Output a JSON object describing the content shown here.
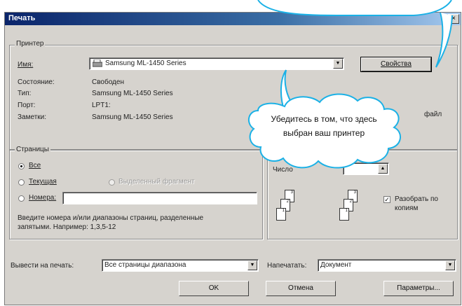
{
  "dialog": {
    "title": "Печать",
    "close_glyph": "×"
  },
  "printer": {
    "legend": "Принтер",
    "name_label": "Имя:",
    "name_value": "Samsung ML-1450 Series",
    "properties_button": "Свойства",
    "status_label": "Состояние:",
    "status_value": "Свободен",
    "type_label": "Тип:",
    "type_value": "Samsung ML-1450 Series",
    "port_label": "Порт:",
    "port_value": "LPT1:",
    "comment_label": "Заметки:",
    "comment_value": "Samsung ML-1450 Series",
    "file_partial": "файл"
  },
  "pages": {
    "legend": "Страницы",
    "all": "Все",
    "current": "Текущая",
    "selection": "Выделенный фрагмент",
    "numbers": "Номера:",
    "numbers_value": "",
    "hint": "Введите номера и/или диапазоны страниц, разделенные запятыми. Например: 1,3,5-12",
    "selected": "all"
  },
  "copies": {
    "count_label_partial": "Число",
    "collate_label": "Разобрать по копиям",
    "collate_checked": true,
    "page_numbers_a": [
      "1",
      "2",
      "3"
    ],
    "page_numbers_b": [
      "1",
      "2",
      "3"
    ]
  },
  "bottom": {
    "print_label": "Вывести на печать:",
    "print_value": "Все страницы диапазона",
    "what_label": "Напечатать:",
    "what_value": "Документ",
    "ok": "OK",
    "cancel": "Отмена",
    "options": "Параметры..."
  },
  "callout": {
    "text": "Убедитесь в том, что здесь выбран ваш принтер",
    "border_color": "#1bb1e6"
  }
}
